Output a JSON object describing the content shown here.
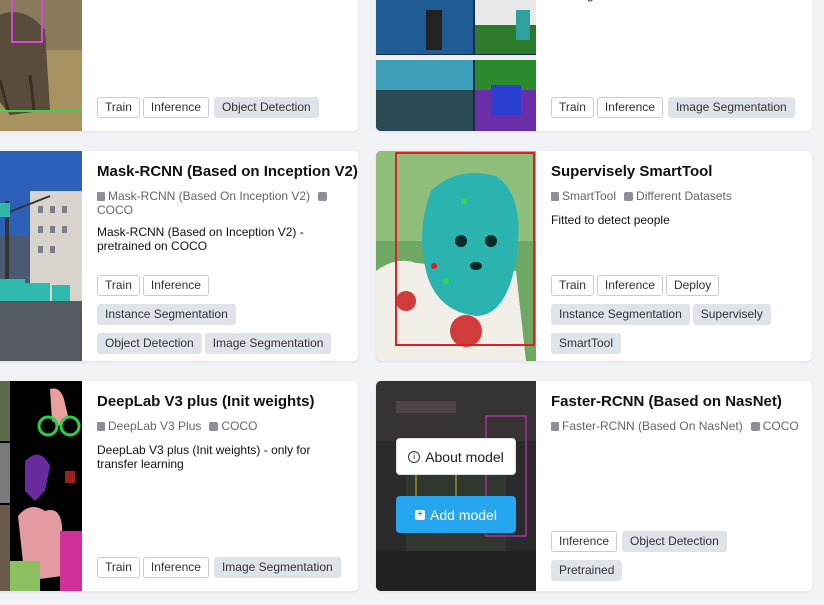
{
  "cards": [
    {
      "id": "card-top-left",
      "tags_primary": [
        "Train",
        "Inference"
      ],
      "tags_categories": [
        "Object Detection"
      ]
    },
    {
      "id": "card-top-right",
      "desc_tail": "learning",
      "tags_primary": [
        "Train",
        "Inference"
      ],
      "tags_categories": [
        "Image Segmentation"
      ]
    },
    {
      "id": "card-mask-rcnn",
      "title": "Mask-RCNN (Based on Inception V2)",
      "meta_name": "Mask-RCNN (Based On Inception V2)",
      "meta_dataset": "COCO",
      "description": "Mask-RCNN (Based on Inception V2) - pretrained on COCO",
      "tags_primary": [
        "Train",
        "Inference"
      ],
      "tags_categories": [
        "Instance Segmentation",
        "Object Detection",
        "Image Segmentation"
      ]
    },
    {
      "id": "card-smarttool",
      "title": "Supervisely SmartTool",
      "meta_name": "SmartTool",
      "meta_dataset": "Different Datasets",
      "description": "Fitted to detect people",
      "tags_primary": [
        "Train",
        "Inference",
        "Deploy"
      ],
      "tags_categories": [
        "Instance Segmentation",
        "Supervisely",
        "SmartTool"
      ]
    },
    {
      "id": "card-deeplab",
      "title": "DeepLab V3 plus (Init weights)",
      "meta_name": "DeepLab V3 Plus",
      "meta_dataset": "COCO",
      "description": "DeepLab V3 plus (Init weights) - only for transfer learning",
      "tags_primary": [
        "Train",
        "Inference"
      ],
      "tags_categories": [
        "Image Segmentation"
      ]
    },
    {
      "id": "card-nasnet",
      "title": "Faster-RCNN (Based on NasNet)",
      "meta_name": "Faster-RCNN (Based On NasNet)",
      "meta_dataset": "COCO",
      "tags_primary": [
        "Inference"
      ],
      "tags_categories": [
        "Object Detection",
        "Pretrained"
      ],
      "about_label": "About model",
      "add_label": "Add model"
    }
  ]
}
